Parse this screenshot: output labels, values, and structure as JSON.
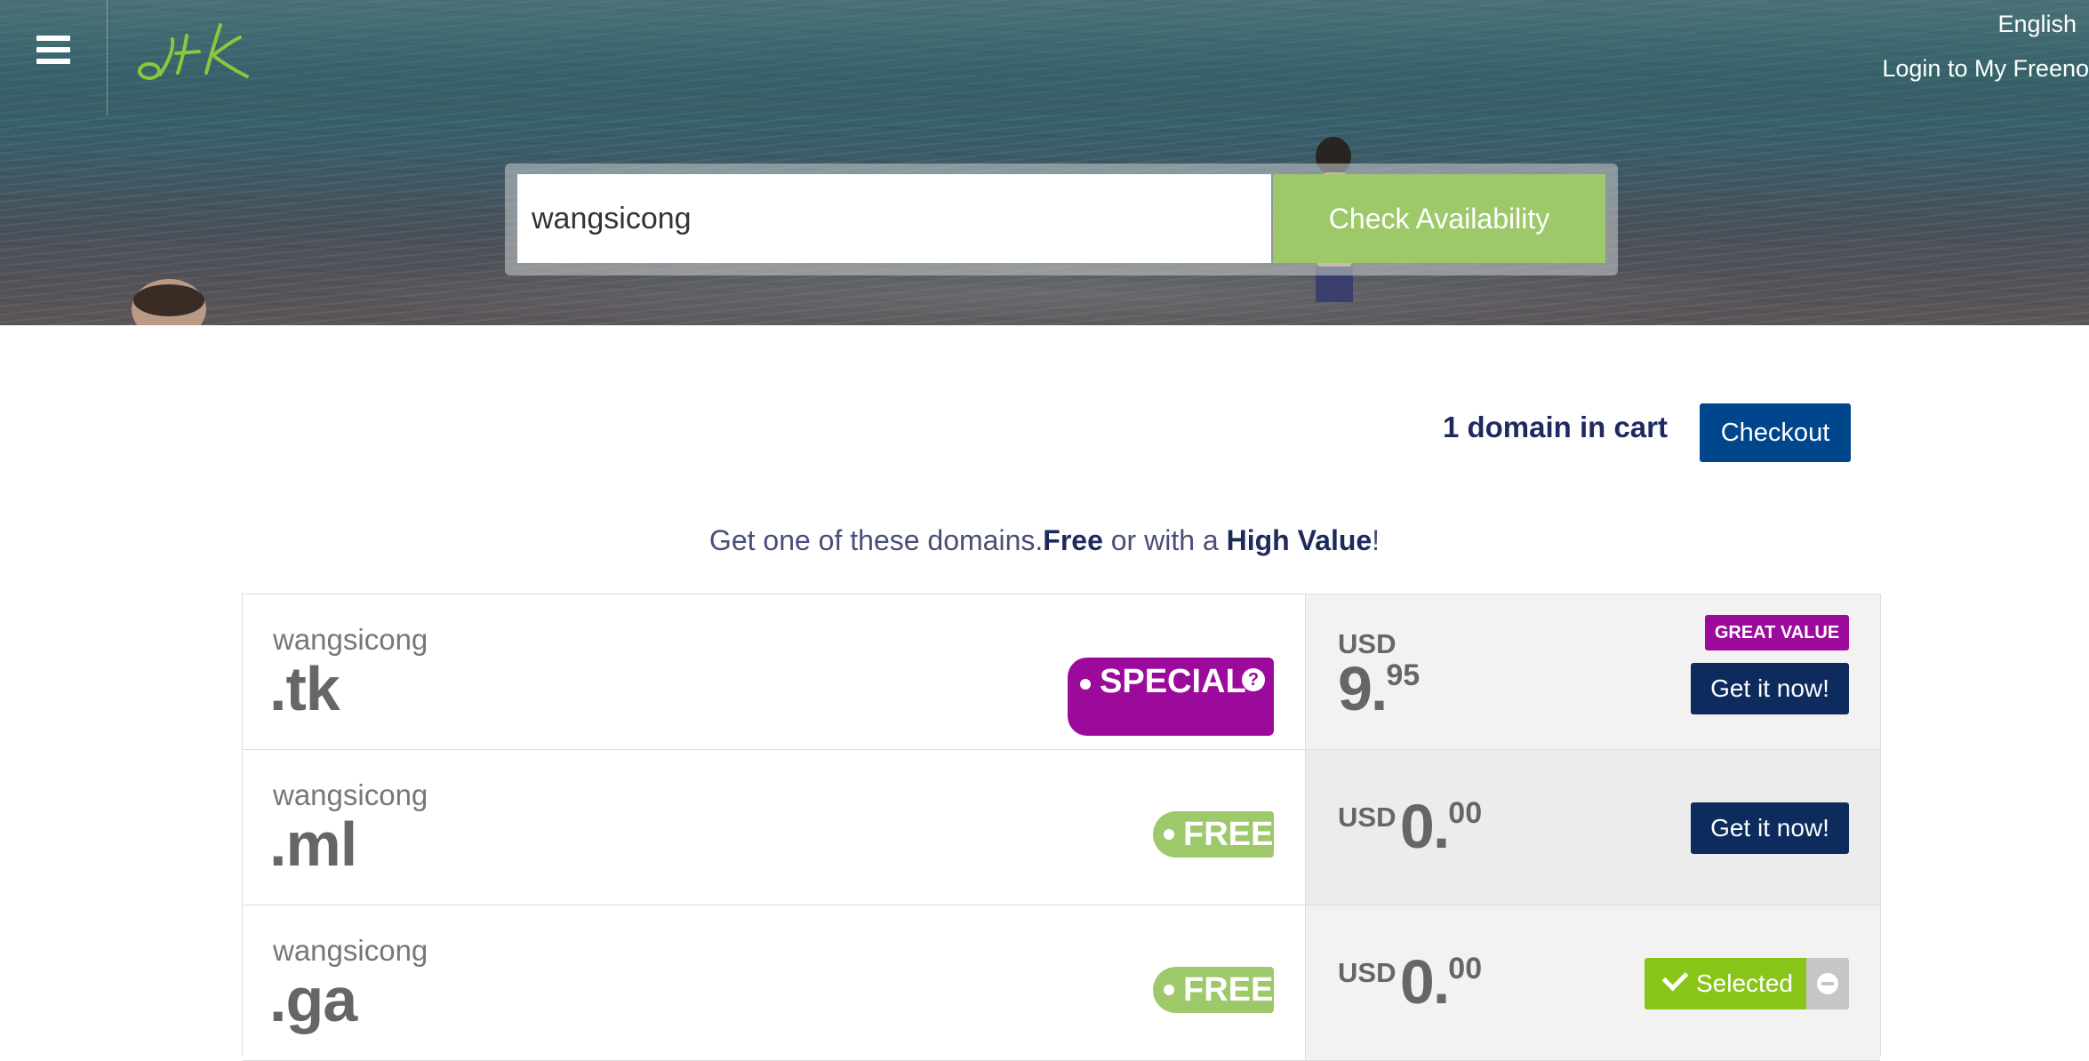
{
  "header": {
    "language_label": "English",
    "login_label": "Login to My Freeno",
    "logo_alt": ".tk",
    "accent_color": "#9dc96b"
  },
  "search": {
    "value": "wangsicong",
    "button_label": "Check Availability"
  },
  "cart": {
    "summary": "1 domain in cart",
    "checkout_label": "Checkout"
  },
  "tagline": {
    "prefix": "Get one of these domains.",
    "free": "Free",
    "middle": " or with a ",
    "high_value": "High Value",
    "suffix": "!"
  },
  "domains": [
    {
      "name": "wangsicong",
      "tld": ".tk",
      "badge": "SPECIAL",
      "badge_help": "?",
      "currency": "USD",
      "price_whole": "9.",
      "price_cents": "95",
      "ribbon": "GREAT VALUE",
      "action_label": "Get it now!"
    },
    {
      "name": "wangsicong",
      "tld": ".ml",
      "badge": "FREE",
      "currency": "USD",
      "price_whole": "0.",
      "price_cents": "00",
      "action_label": "Get it now!"
    },
    {
      "name": "wangsicong",
      "tld": ".ga",
      "badge": "FREE",
      "currency": "USD",
      "price_whole": "0.",
      "price_cents": "00",
      "action_label": "Selected"
    }
  ]
}
